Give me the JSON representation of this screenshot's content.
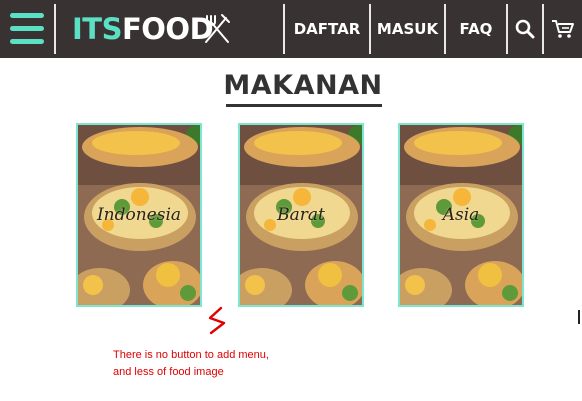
{
  "navbar": {
    "logo": {
      "its": "ITS",
      "food": "FOOD"
    },
    "items": [
      {
        "label": "DAFTAR"
      },
      {
        "label": "MASUK"
      },
      {
        "label": "FAQ"
      }
    ],
    "icons": {
      "menu": "hamburger-icon",
      "logo": "fork-knife-icon",
      "search": "search-icon",
      "cart": "cart-icon"
    },
    "colors": {
      "background": "#383233",
      "accent": "#5ce0c4"
    }
  },
  "main": {
    "title": "MAKANAN",
    "cards": [
      {
        "label": "Indonesia"
      },
      {
        "label": "Barat"
      },
      {
        "label": "Asia"
      }
    ]
  },
  "annotation": {
    "lines": [
      "There is no button to add menu,",
      "and less of food image"
    ],
    "color": "#e00000"
  }
}
